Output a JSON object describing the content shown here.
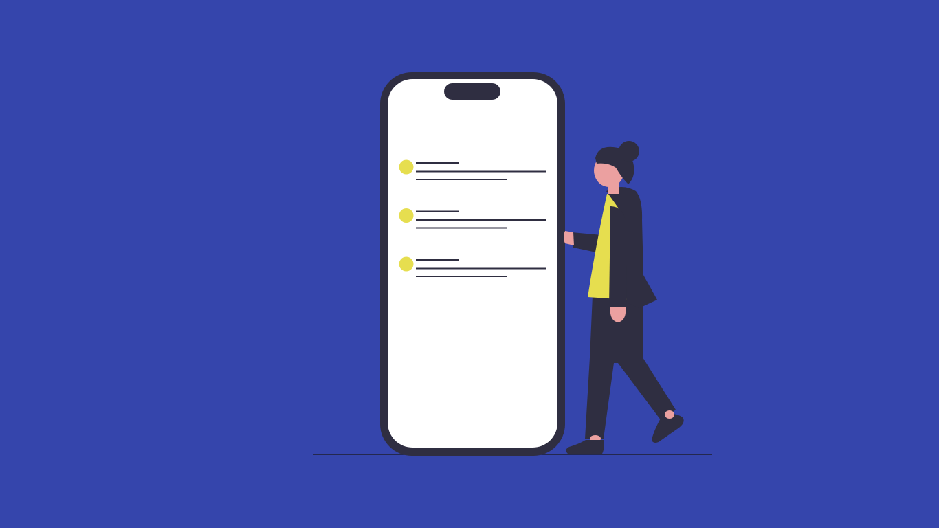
{
  "colors": {
    "background": "#3545AC",
    "phone_frame": "#2F2E41",
    "phone_screen": "#FFFFFF",
    "bullet": "#E6DE4F",
    "text_line": "#2F2E41",
    "skin": "#EBA0A0",
    "shirt": "#E6DE4F",
    "jacket": "#2F2E41",
    "ground_line": "#1E1E2E"
  },
  "phone": {
    "screen_list": [
      {
        "icon": "bullet-dot"
      },
      {
        "icon": "bullet-dot"
      },
      {
        "icon": "bullet-dot"
      }
    ]
  },
  "figure": {
    "icon": "woman-walking-figure"
  }
}
